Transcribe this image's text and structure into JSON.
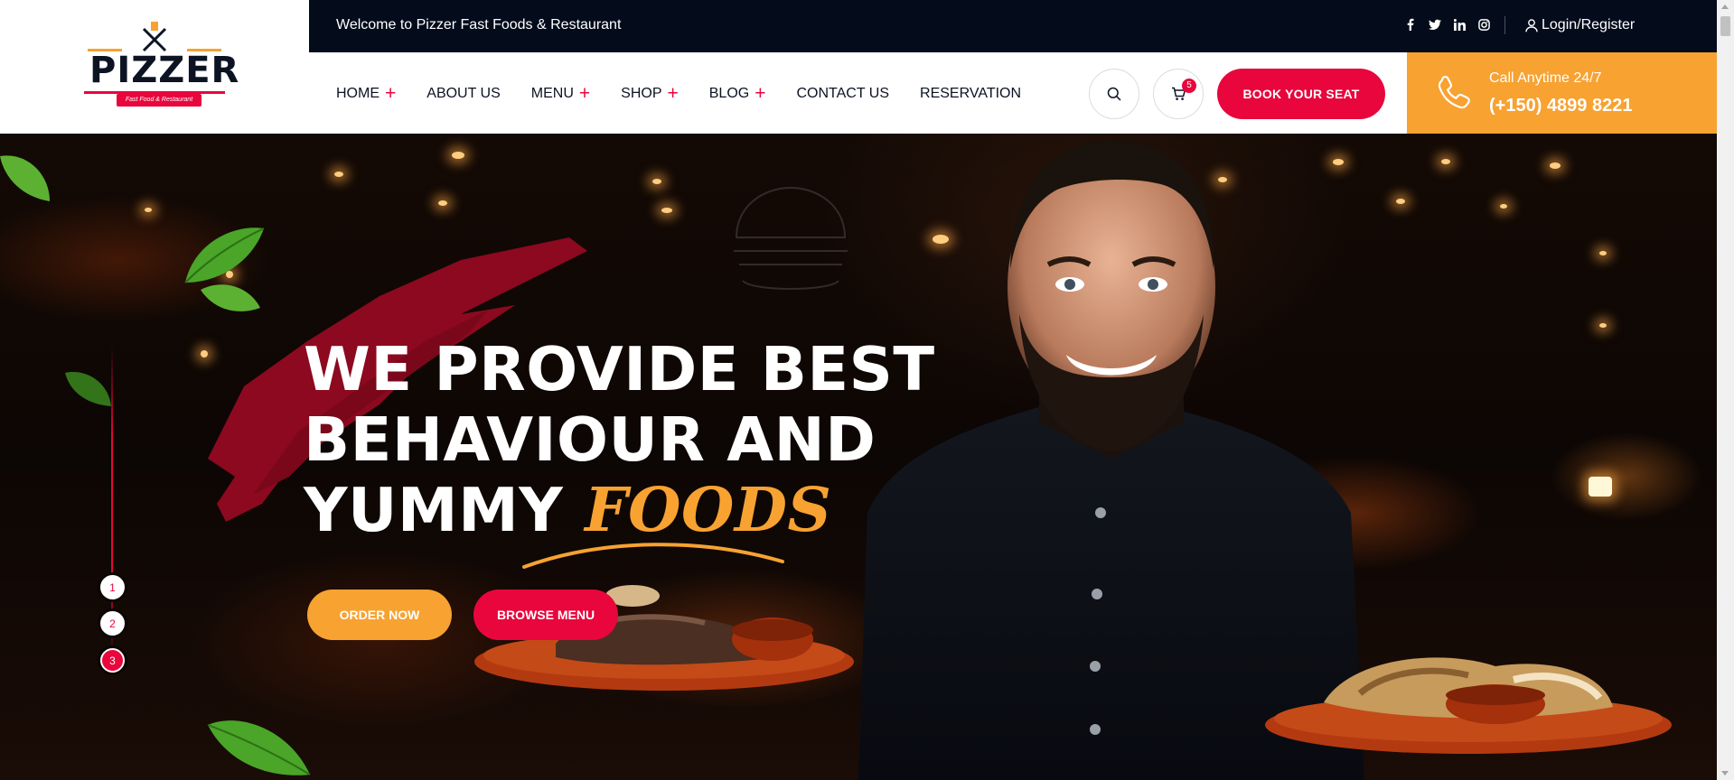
{
  "brand": {
    "name": "PIZZER",
    "tagline": "Fast Food & Restaurant",
    "colors": {
      "primary": "#e8063c",
      "accent": "#f7a231",
      "dark": "#040c1c"
    }
  },
  "topbar": {
    "welcome": "Welcome to Pizzer Fast Foods & Restaurant",
    "social_icons": [
      "facebook-icon",
      "twitter-icon",
      "linkedin-icon",
      "instagram-icon"
    ],
    "login_label": "Login/Register"
  },
  "nav": {
    "items": [
      {
        "label": "HOME",
        "has_submenu": true
      },
      {
        "label": "ABOUT US",
        "has_submenu": false
      },
      {
        "label": "MENU",
        "has_submenu": true
      },
      {
        "label": "SHOP",
        "has_submenu": true
      },
      {
        "label": "BLOG",
        "has_submenu": true
      },
      {
        "label": "CONTACT US",
        "has_submenu": false
      },
      {
        "label": "RESERVATION",
        "has_submenu": false
      }
    ],
    "submenu_symbol": "+",
    "cart_count": "5",
    "book_label": "BOOK YOUR SEAT"
  },
  "call": {
    "label": "Call Anytime 24/7",
    "number": "(+150) 4899 8221"
  },
  "hero": {
    "title_line1": "WE PROVIDE BEST",
    "title_line2": "BEHAVIOUR AND",
    "title_line3_plain": "YUMMY ",
    "title_line3_accent": "FOODS",
    "order_label": "ORDER NOW",
    "browse_label": "BROWSE MENU",
    "slides": [
      "1",
      "2",
      "3"
    ],
    "active_slide": "3"
  }
}
